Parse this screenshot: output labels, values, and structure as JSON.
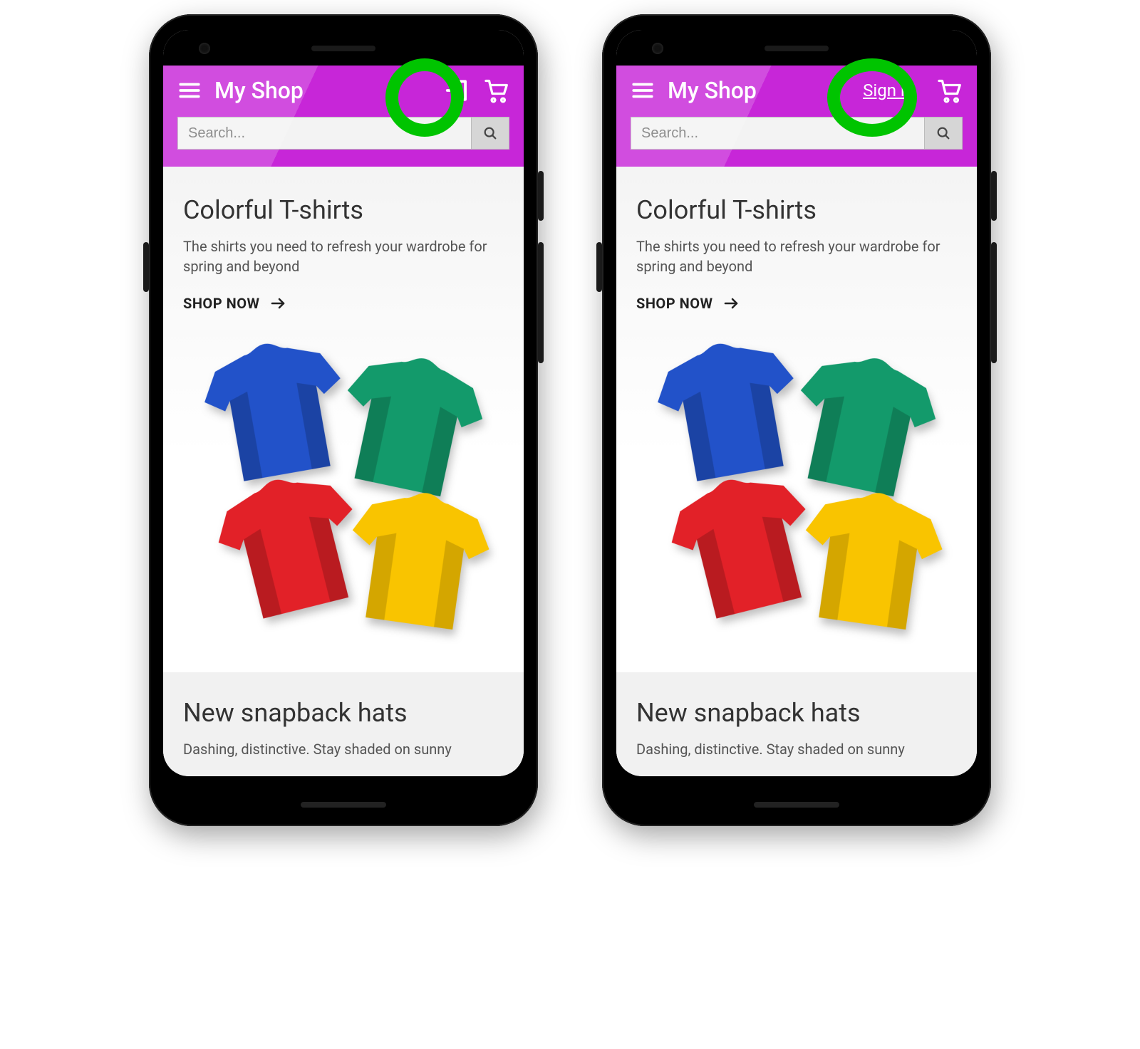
{
  "app": {
    "title": "My Shop"
  },
  "header": {
    "signin_label": "Sign in",
    "search_placeholder": "Search..."
  },
  "hero": {
    "title": "Colorful T-shirts",
    "subtitle": "The shirts you need to refresh your wardrobe for spring and beyond",
    "cta": "SHOP NOW"
  },
  "section2": {
    "title": "New snapback hats",
    "subtitle_partial": "Dashing, distinctive. Stay shaded on sunny"
  },
  "colors": {
    "accent": "#c726d8",
    "highlight": "#00c400"
  },
  "shirts": {
    "blue": "#2252c9",
    "green": "#139a6b",
    "red": "#e22128",
    "yellow": "#f9c400"
  }
}
